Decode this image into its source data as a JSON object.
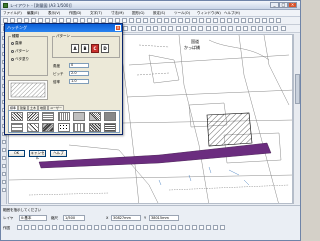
{
  "window": {
    "title": "レイアウト - [測量図 (A3 1/500)]",
    "minimize": "_",
    "maximize": "□",
    "close": "×"
  },
  "menubar": {
    "items": [
      "ファイル(F)",
      "編集(E)",
      "表示(V)",
      "作図(D)",
      "文字(T)",
      "寸法(M)",
      "図形(G)",
      "設定(S)",
      "ツール(O)",
      "ウィンドウ(W)",
      "ヘルプ(H)"
    ]
  },
  "map": {
    "label_top": "国道",
    "label_top2": "かっぱ橋",
    "hatch_color": "#000000",
    "band_color": "#6b2d7f",
    "road_color": "#8a8a8a"
  },
  "dialog": {
    "title": "ハッチング",
    "close": "×",
    "group_type": {
      "title": "種類",
      "options": [
        "直線",
        "パターン",
        "ベタ塗り"
      ],
      "selected": 1
    },
    "group_pattern": {
      "title": "パターン",
      "buttons": [
        "A",
        "B",
        "C",
        "D"
      ],
      "selected": 2
    },
    "fields": {
      "angle_label": "角度",
      "angle_value": "0",
      "pitch_label": "ピッチ",
      "pitch_value": "2.0",
      "scale_label": "倍率",
      "scale_value": "1.0"
    },
    "tabs": [
      "標準",
      "建築",
      "土木",
      "地図",
      "ユーザー"
    ],
    "buttons": {
      "ok": "OK",
      "cancel": "キャンセル",
      "help": "ヘルプ"
    }
  },
  "statusbar": {
    "layer_label": "レイヤ",
    "layer_value": "0:基本",
    "scale_label": "縮尺",
    "scale_value": "1/500",
    "x_label": "X",
    "x_value": "30827mm",
    "y_label": "Y",
    "y_value": "38015mm",
    "message": "範囲を指示してください",
    "mode": "作図"
  }
}
